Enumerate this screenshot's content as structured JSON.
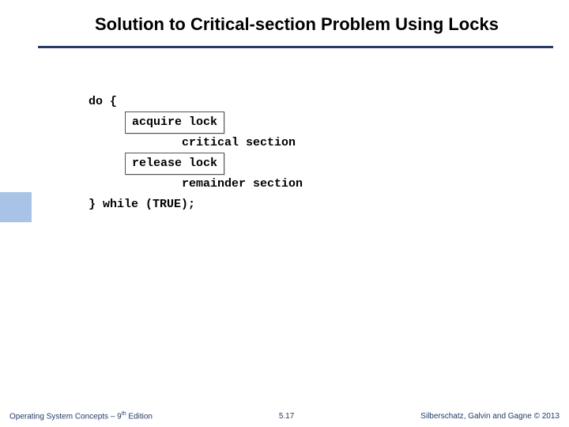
{
  "title": "Solution to Critical-section Problem Using Locks",
  "code": {
    "do_open": "do {",
    "acquire": "acquire lock",
    "critical": "critical section",
    "release": "release lock",
    "remainder": "remainder section",
    "close": "} while (TRUE);"
  },
  "footer": {
    "left_prefix": "Operating System Concepts – 9",
    "left_sup": "th",
    "left_suffix": " Edition",
    "center": "5.17",
    "right": "Silberschatz, Galvin and Gagne © 2013"
  }
}
